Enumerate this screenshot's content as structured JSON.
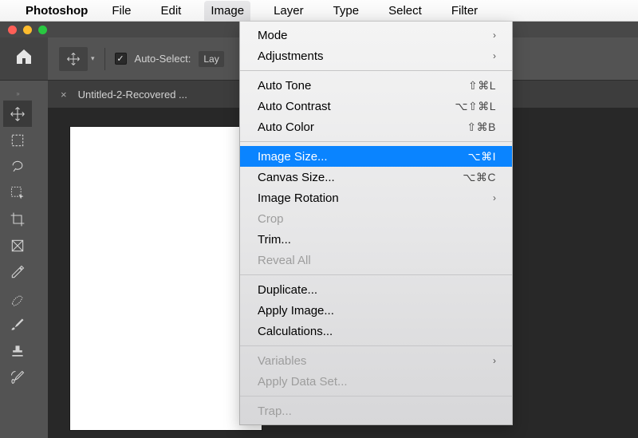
{
  "menubar": {
    "app_name": "Photoshop",
    "items": [
      "File",
      "Edit",
      "Image",
      "Layer",
      "Type",
      "Select",
      "Filter"
    ],
    "open_index": 2
  },
  "options_bar": {
    "auto_select_label": "Auto-Select:",
    "layer_label": "Lay"
  },
  "document": {
    "tab_title": "Untitled-2-Recovered ..."
  },
  "dropdown": {
    "groups": [
      [
        {
          "label": "Mode",
          "submenu": true
        },
        {
          "label": "Adjustments",
          "submenu": true
        }
      ],
      [
        {
          "label": "Auto Tone",
          "shortcut": "⇧⌘L"
        },
        {
          "label": "Auto Contrast",
          "shortcut": "⌥⇧⌘L"
        },
        {
          "label": "Auto Color",
          "shortcut": "⇧⌘B"
        }
      ],
      [
        {
          "label": "Image Size...",
          "shortcut": "⌥⌘I",
          "highlighted": true
        },
        {
          "label": "Canvas Size...",
          "shortcut": "⌥⌘C"
        },
        {
          "label": "Image Rotation",
          "submenu": true
        },
        {
          "label": "Crop",
          "disabled": true
        },
        {
          "label": "Trim..."
        },
        {
          "label": "Reveal All",
          "disabled": true
        }
      ],
      [
        {
          "label": "Duplicate..."
        },
        {
          "label": "Apply Image..."
        },
        {
          "label": "Calculations..."
        }
      ],
      [
        {
          "label": "Variables",
          "submenu": true,
          "disabled": true
        },
        {
          "label": "Apply Data Set...",
          "disabled": true
        }
      ],
      [
        {
          "label": "Trap...",
          "disabled": true
        }
      ]
    ]
  }
}
